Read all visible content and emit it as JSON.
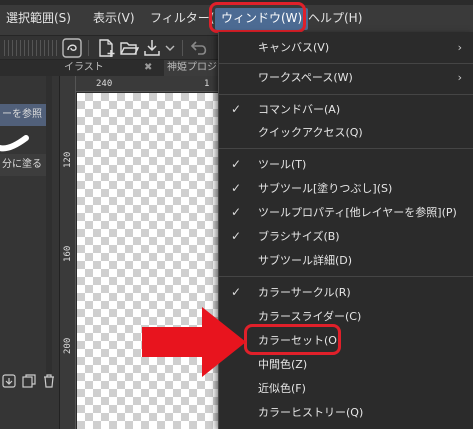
{
  "menubar": {
    "items": [
      {
        "label": "選択範囲(S)"
      },
      {
        "label": "表示(V)"
      },
      {
        "label": "フィルター(I)"
      },
      {
        "label": "ウィンドウ(W)"
      },
      {
        "label": "ヘルプ(H)"
      }
    ]
  },
  "left_panel": {
    "rows": [
      {
        "label": "ーを参照"
      },
      {
        "label": "分に塗る"
      }
    ]
  },
  "tabs": {
    "illust": "イラスト",
    "close": "✖",
    "project": "神姫プロジェ"
  },
  "ruler": {
    "top": [
      "240",
      "1"
    ],
    "left": [
      "120",
      "160",
      "200"
    ]
  },
  "dropdown": {
    "items": [
      {
        "label": "キャンバス(V)",
        "checked": false,
        "submenu": true
      },
      {
        "label": "ワークスペース(W)",
        "checked": false,
        "submenu": true
      },
      {
        "label": "コマンドバー(A)",
        "checked": true,
        "submenu": false
      },
      {
        "label": "クイックアクセス(Q)",
        "checked": false,
        "submenu": false
      },
      {
        "label": "ツール(T)",
        "checked": true,
        "submenu": false
      },
      {
        "label": "サブツール[塗りつぶし](S)",
        "checked": true,
        "submenu": false
      },
      {
        "label": "ツールプロパティ[他レイヤーを参照](P)",
        "checked": true,
        "submenu": false
      },
      {
        "label": "ブラシサイズ(B)",
        "checked": true,
        "submenu": false
      },
      {
        "label": "サブツール詳細(D)",
        "checked": false,
        "submenu": false
      },
      {
        "label": "カラーサークル(R)",
        "checked": true,
        "submenu": false
      },
      {
        "label": "カラースライダー(C)",
        "checked": false,
        "submenu": false
      },
      {
        "label": "カラーセット(O)",
        "checked": false,
        "submenu": false
      },
      {
        "label": "中間色(Z)",
        "checked": false,
        "submenu": false
      },
      {
        "label": "近似色(F)",
        "checked": false,
        "submenu": false
      },
      {
        "label": "カラーヒストリー(Q)",
        "checked": false,
        "submenu": false
      }
    ],
    "check_glyph": "✓",
    "arrow_glyph": "›"
  },
  "icons": [
    "vector-icon",
    "new-canvas-icon",
    "open-folder-icon",
    "save-icon",
    "undo-icon",
    "add-layer-icon",
    "copy-layer-icon",
    "trash-icon"
  ],
  "colors": {
    "highlight": "#e0202a",
    "active_menu": "#4c6b93",
    "arrow": "#e8141e"
  }
}
